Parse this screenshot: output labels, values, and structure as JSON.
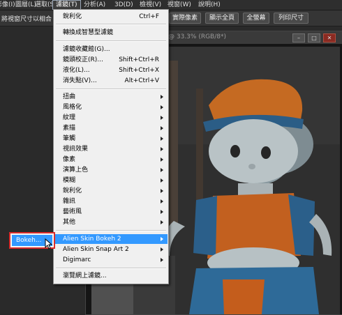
{
  "menubar": {
    "items": [
      "影像(I)",
      "圖層(L)",
      "選取(S)",
      "濾鏡(T)",
      "分析(A)",
      "3D(D)",
      "檢視(V)",
      "視窗(W)",
      "說明(H)"
    ]
  },
  "options": {
    "fit_label": "將視窗尺寸以相合",
    "buttons": [
      "實際像素",
      "顯示全頁",
      "全螢幕",
      "列印尺寸"
    ]
  },
  "document": {
    "title": "@ 33.3% (RGB/8*)"
  },
  "filter_menu": {
    "top": [
      {
        "label": "銳利化",
        "shortcut": "Ctrl+F"
      },
      {
        "label": "轉換成智慧型濾鏡",
        "shortcut": ""
      }
    ],
    "group2": [
      {
        "label": "濾鏡收藏館(G)...",
        "shortcut": ""
      },
      {
        "label": "鏡頭校正(R)...",
        "shortcut": "Shift+Ctrl+R"
      },
      {
        "label": "液化(L)...",
        "shortcut": "Shift+Ctrl+X"
      },
      {
        "label": "消失點(V)...",
        "shortcut": "Alt+Ctrl+V"
      }
    ],
    "group3": [
      "扭曲",
      "風格化",
      "紋理",
      "素描",
      "筆觸",
      "視訊效果",
      "像素",
      "演算上色",
      "模糊",
      "銳利化",
      "雜訊",
      "藝術風",
      "其他"
    ],
    "group4": [
      "Alien Skin Bokeh 2",
      "Alien Skin Snap Art 2",
      "Digimarc"
    ],
    "group5": [
      "瀏覽網上濾鏡..."
    ]
  },
  "submenu": {
    "item": "Bokeh..."
  },
  "colors": {
    "highlight": "#3399ff",
    "annotation": "#d92b2b"
  }
}
